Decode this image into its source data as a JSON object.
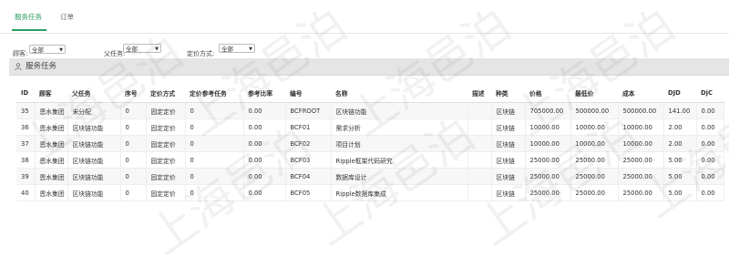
{
  "tabs": [
    {
      "label": "服务任务",
      "active": true
    },
    {
      "label": "订单",
      "active": false
    }
  ],
  "filters": {
    "customer": {
      "label": "顾客:",
      "value": "全部"
    },
    "parent_task": {
      "label": "父任务:",
      "value": "全部"
    },
    "pricing_method": {
      "label": "定价方式:",
      "value": "全部"
    }
  },
  "panel": {
    "title": "服务任务",
    "icon": "user-icon"
  },
  "table": {
    "columns": [
      "ID",
      "顾客",
      "父任务",
      "序号",
      "定价方式",
      "定价参考任务",
      "参考比率",
      "编号",
      "名称",
      "描述",
      "种类",
      "价格",
      "最低价",
      "成本",
      "DJD",
      "DjC"
    ],
    "rows": [
      [
        "35",
        "恩水集团",
        "未分配",
        "0",
        "固定定价",
        "0",
        "0.00",
        "BCFROOT",
        "区块链功能",
        "",
        "区块链",
        "705000.00",
        "500000.00",
        "500000.00",
        "141.00",
        "0.00"
      ],
      [
        "36",
        "恩水集团",
        "区块链功能",
        "0",
        "固定定价",
        "0",
        "0.00",
        "BCF01",
        "需求分析",
        "",
        "区块链",
        "10000.00",
        "10000.00",
        "10000.00",
        "2.00",
        "0.00"
      ],
      [
        "37",
        "恩水集团",
        "区块链功能",
        "0",
        "固定定价",
        "0",
        "0.00",
        "BCF02",
        "项目计划",
        "",
        "区块链",
        "10000.00",
        "10000.00",
        "10000.00",
        "2.00",
        "0.00"
      ],
      [
        "38",
        "恩水集团",
        "区块链功能",
        "0",
        "固定定价",
        "0",
        "0.00",
        "BCF03",
        "Ripple框架代码研究",
        "",
        "区块链",
        "25000.00",
        "25000.00",
        "25000.00",
        "5.00",
        "0.00"
      ],
      [
        "39",
        "恩水集团",
        "区块链功能",
        "0",
        "固定定价",
        "0",
        "0.00",
        "BCF04",
        "数据库设计",
        "",
        "区块链",
        "25000.00",
        "25000.00",
        "25000.00",
        "5.00",
        "0.00"
      ],
      [
        "40",
        "恩水集团",
        "区块链功能",
        "0",
        "固定定价",
        "0",
        "0.00",
        "BCF05",
        "Ripple数据库集成",
        "",
        "区块链",
        "25000.00",
        "25000.00",
        "25000.00",
        "5.00",
        "0.00"
      ]
    ]
  },
  "watermark": "上海邑泊",
  "colors": {
    "accent": "#2a9d5f",
    "panel_bg": "#e5e5e5",
    "stripe": "#f7f7f7"
  }
}
